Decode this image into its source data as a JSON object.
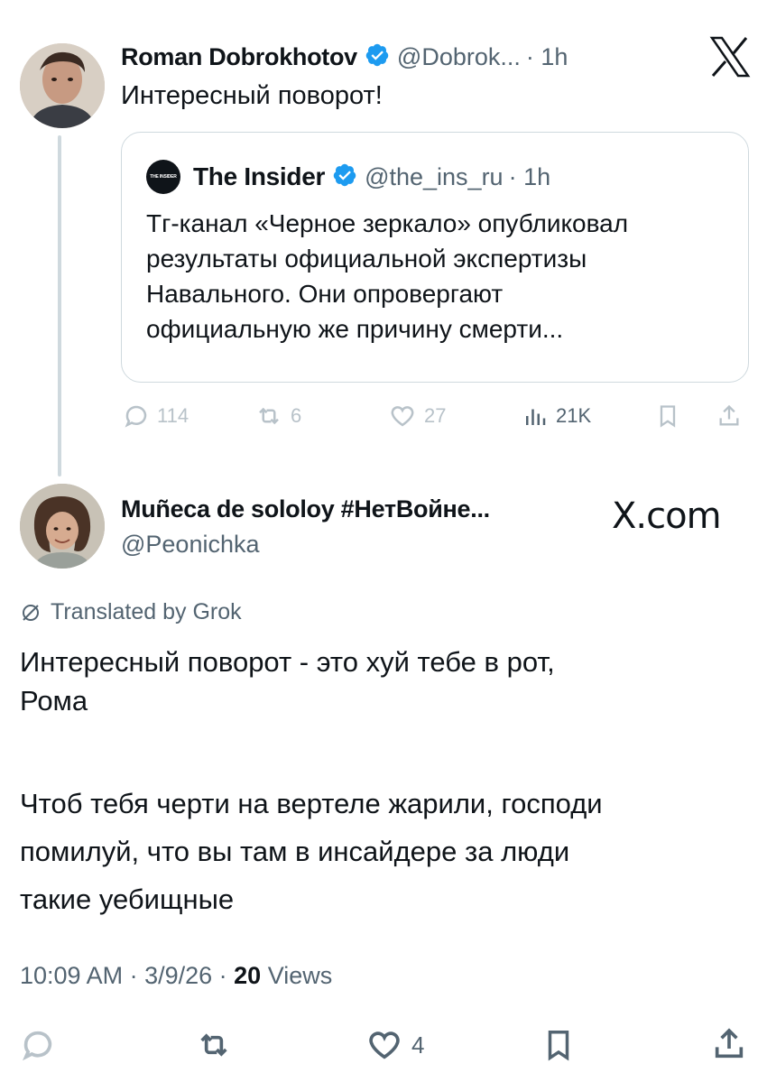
{
  "parent_tweet": {
    "author_name": "Roman Dobrokhotov",
    "author_handle": "@Dobrok...",
    "time": "· 1h",
    "text": "Интересный поворот!",
    "avatar_icon": "person-avatar",
    "quoted": {
      "source_badge": "THE INSIDER",
      "author_name": "The Insider",
      "author_handle": "@the_ins_ru",
      "time": "· 1h",
      "text_lines": [
        "Тг-канал «Черное зеркало» опубликовал",
        "результаты официальной экспертизы",
        "Навального. Они опровергают",
        "официальную же причину смерти..."
      ]
    },
    "actions": {
      "replies": "114",
      "reposts": "6",
      "likes": "27",
      "views": "21K"
    }
  },
  "reply_tweet": {
    "author_name": "Muñeca de sololoy #НетВойне...",
    "author_handle": "@Peonichka",
    "translated_label": "Translated by Grok",
    "paragraph1_lines": [
      "Интересный поворот - это хуй тебе в рот,",
      "Рома"
    ],
    "paragraph2_lines": [
      "Чтоб тебя черти на вертеле жарили, господи",
      "помилуй, что вы там в инсайдере за люди",
      "такие уебищные"
    ],
    "meta": {
      "time": "10:09 AM · 3/9/26 · ",
      "views_count": "20",
      "views_label": " Views"
    },
    "actions": {
      "likes": "4"
    }
  },
  "watermarks": {
    "top_logo": "X",
    "bottom_logo": "X.com"
  },
  "colors": {
    "verified_blue": "#1d9bf0",
    "secondary_text": "#536471",
    "border": "#cfd9de"
  }
}
